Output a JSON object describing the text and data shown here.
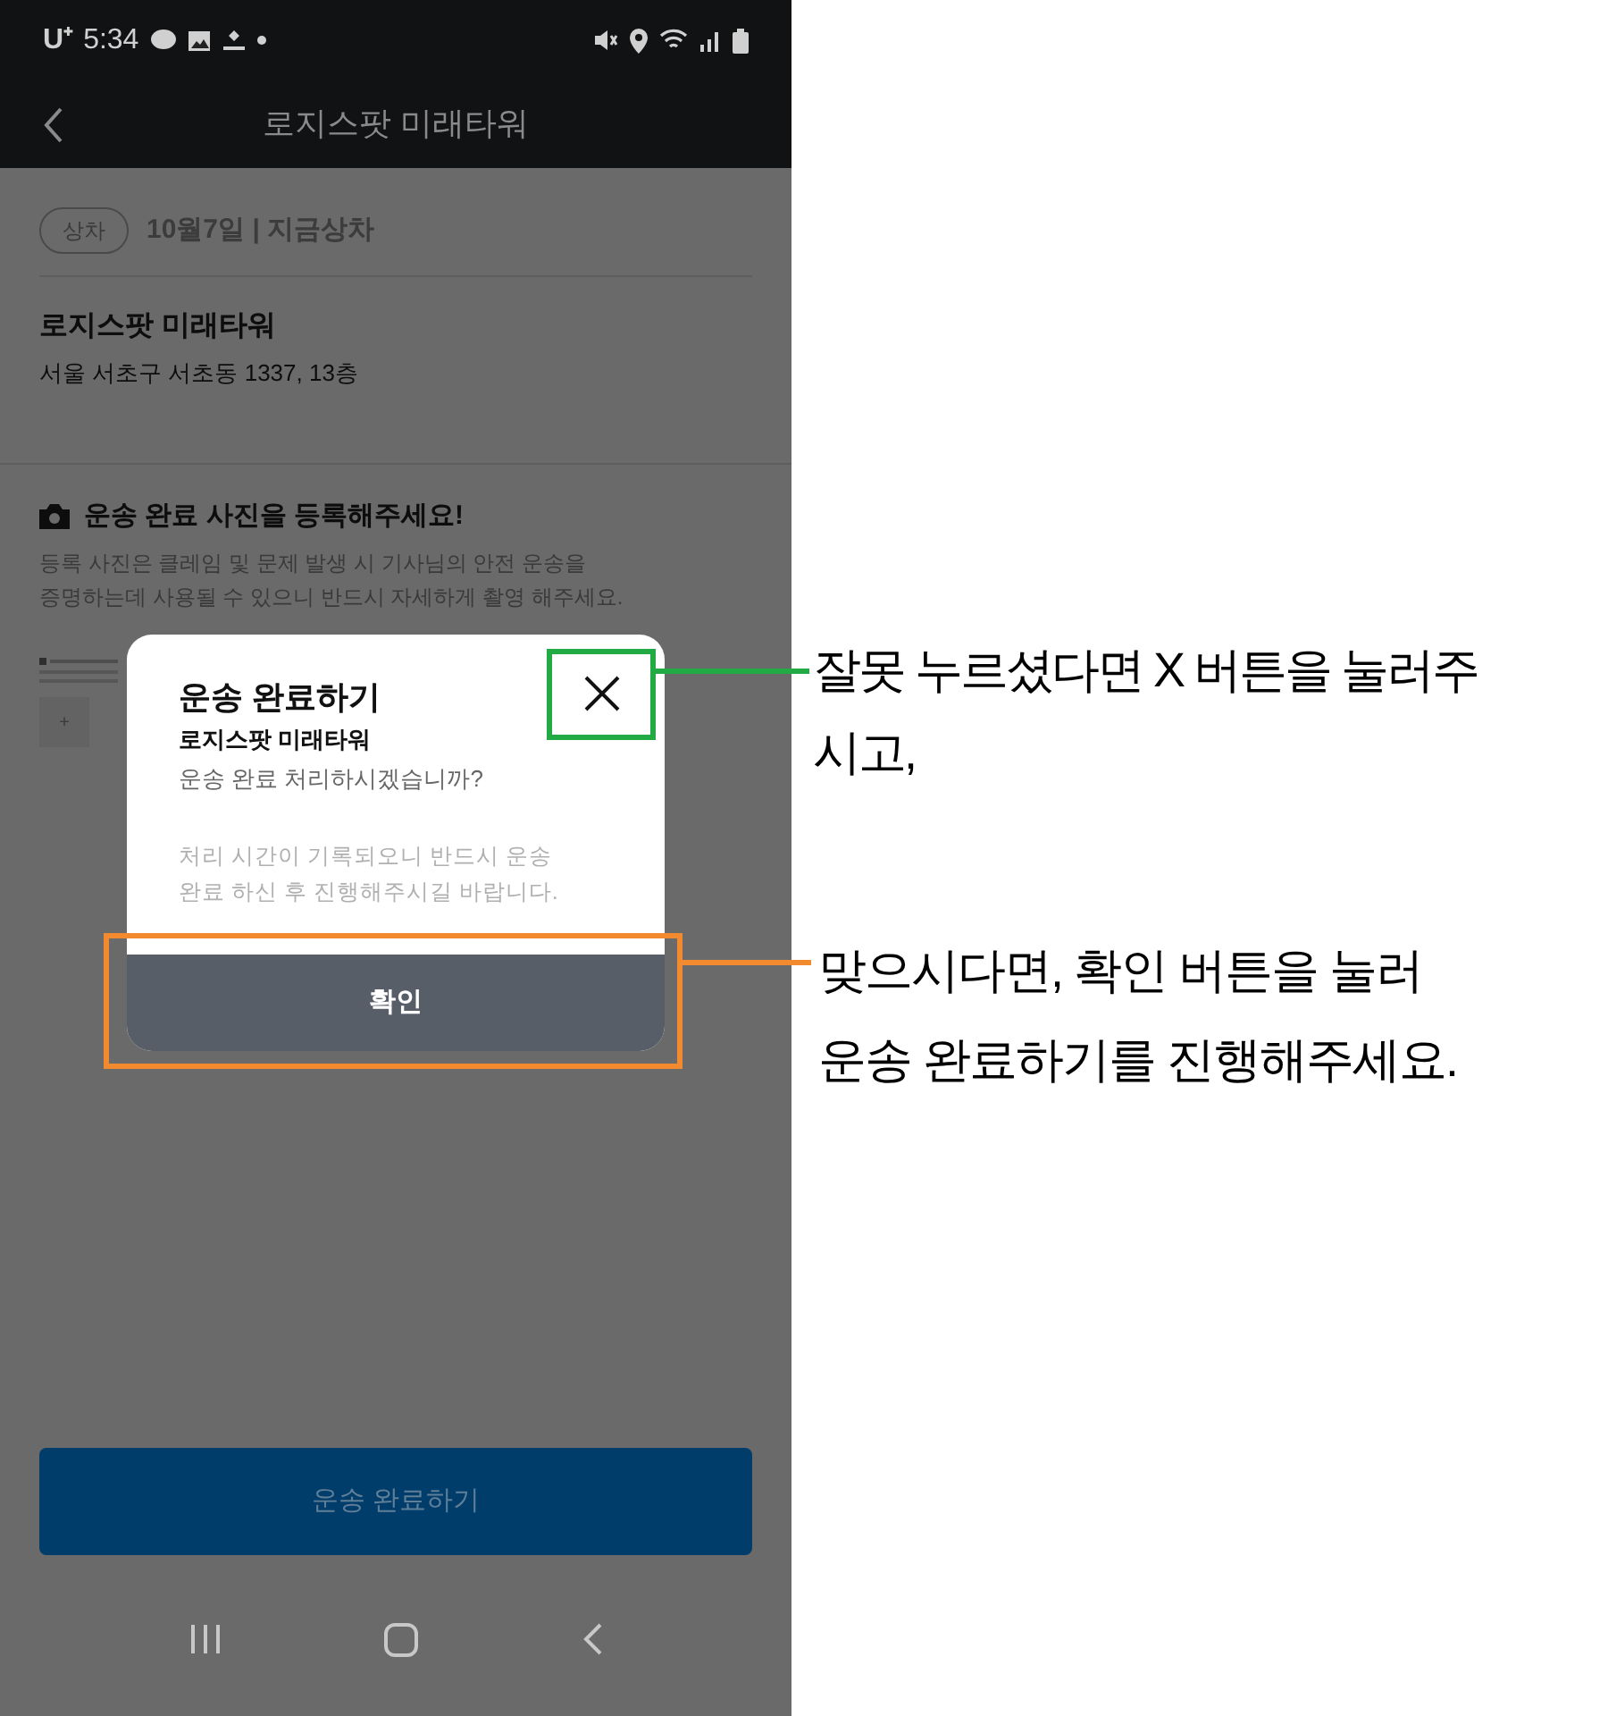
{
  "status_bar": {
    "carrier": "U⁺",
    "time": "5:34"
  },
  "header": {
    "title": "로지스팟 미래타워"
  },
  "order": {
    "badge": "상차",
    "schedule": "10월7일 | 지금상차",
    "place": "로지스팟 미래타워",
    "address": "서울 서초구 서초동 1337, 13층"
  },
  "photo_section": {
    "title": "운송 완료 사진을 등록해주세요!",
    "description": "등록 사진은 클레임 및 문제 발생 시 기사님의 안전 운송을\n증명하는데 사용될 수 있으니 반드시 자세하게 촬영 해주세요.",
    "add_icon": "+"
  },
  "dialog": {
    "title": "운송 완료하기",
    "place": "로지스팟 미래타워",
    "question": "운송 완료 처리하시겠습니까?",
    "notice": "처리 시간이 기록되오니 반드시 운송\n완료 하신 후 진행해주시길 바랍니다.",
    "confirm": "확인"
  },
  "complete_button": "운송 완료하기",
  "annotations": [
    {
      "text": "잘못 누르셨다면 X 버튼을 눌러주\n시고,",
      "color": "#22aa44"
    },
    {
      "text": "맞으시다면, 확인 버튼을 눌러\n운송 완료하기를 진행해주세요.",
      "color": "#f28a30"
    }
  ]
}
